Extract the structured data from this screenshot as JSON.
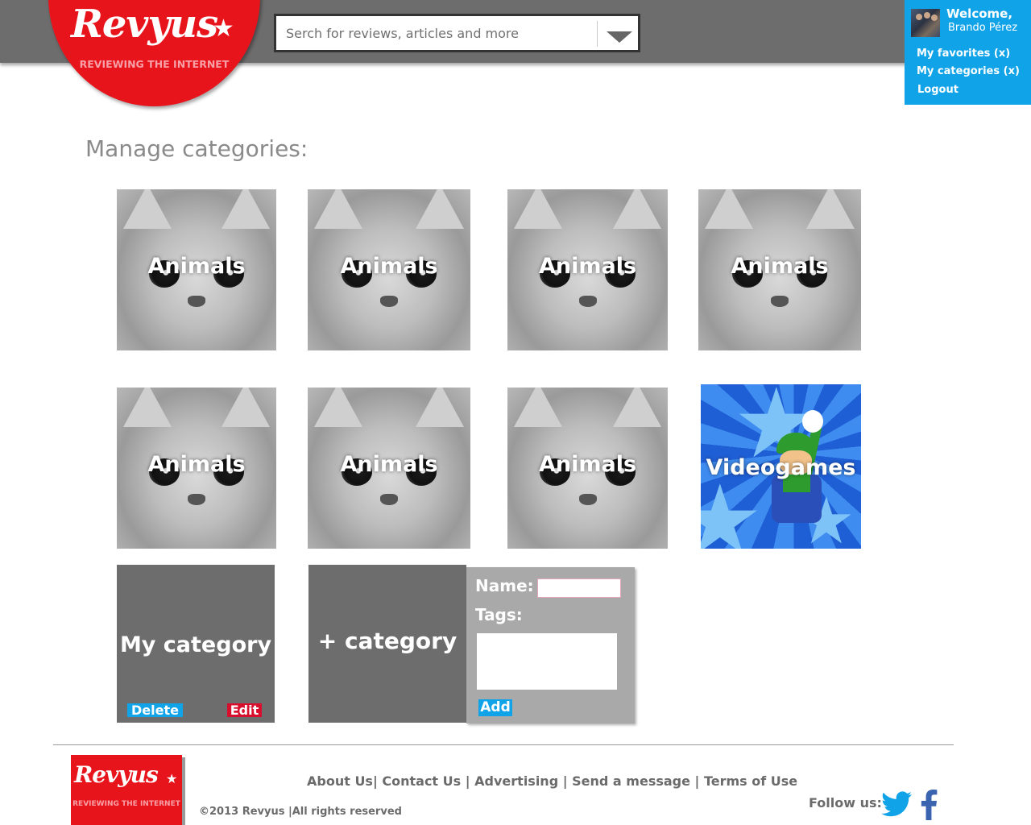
{
  "brand": {
    "logo_text": "Revyus",
    "tagline": "REVIEWING THE INTERNET"
  },
  "search": {
    "placeholder": "Serch for reviews, articles and more",
    "value": ""
  },
  "user_panel": {
    "welcome": "Welcome,",
    "username": "Brando Pérez",
    "links": [
      "My favorites (x)",
      "My categories (x)",
      "Logout"
    ]
  },
  "page": {
    "title": "Manage categories:"
  },
  "categories": [
    {
      "label": "Animals",
      "image": "kitten-photo"
    },
    {
      "label": "Animals",
      "image": "kitten-photo"
    },
    {
      "label": "Animals",
      "image": "kitten-photo"
    },
    {
      "label": "Animals",
      "image": "kitten-photo"
    },
    {
      "label": "Animals",
      "image": "kitten-photo"
    },
    {
      "label": "Animals",
      "image": "kitten-photo"
    },
    {
      "label": "Animals",
      "image": "kitten-photo"
    },
    {
      "label": "Videogames",
      "image": "videogame-character"
    }
  ],
  "my_category": {
    "label": "My category",
    "delete_label": "Delete",
    "edit_label": "Edit"
  },
  "add_category": {
    "label": "+ category",
    "form": {
      "name_label": "Name:",
      "name_value": "",
      "tags_label": "Tags:",
      "tags_value": "",
      "submit_label": "Add"
    }
  },
  "footer": {
    "links": [
      "About Us",
      "Contact Us",
      "Advertising",
      "Send a message",
      "Terms of Use"
    ],
    "copyright": "©2013 Revyus |All rights reserved",
    "follow_label": "Follow us:",
    "social_icons": [
      "twitter-icon",
      "facebook-icon"
    ]
  },
  "colors": {
    "brand_red": "#e8141c",
    "accent_blue": "#11a3e8",
    "header_gray": "#6d6d6d",
    "edit_red": "#d80f2c"
  }
}
